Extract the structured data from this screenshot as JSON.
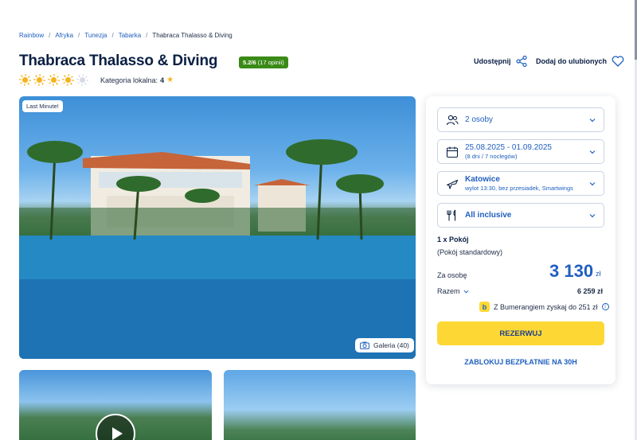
{
  "breadcrumb": [
    {
      "label": "Rainbow"
    },
    {
      "label": "Afryka"
    },
    {
      "label": "Tunezja"
    },
    {
      "label": "Tabarka"
    }
  ],
  "breadcrumb_current": "Thabraca Thalasso & Diving",
  "breadcrumb_separator": "/",
  "hotel": {
    "title": "Thabraca Thalasso & Diving",
    "rating_score": "5.2/6",
    "rating_reviews": "(17 opinii)",
    "sun_rating": 4,
    "sun_max": 5,
    "local_category_label": "Kategoria lokalna:",
    "local_category_value": "4"
  },
  "actions": {
    "share_label": "Udostępnij",
    "favorite_label": "Dodaj do ulubionych"
  },
  "photo": {
    "badge": "Last Minute!",
    "gallery_label": "Galeria (40)"
  },
  "booking": {
    "persons": "2 osoby",
    "dates": "25.08.2025 - 01.09.2025",
    "dates_sub": "(8 dni / 7 noclegów)",
    "departure": "Katowice",
    "departure_sub": "wylot 13:30, bez przesiadek, Smartwings",
    "board": "All inclusive",
    "room_count": "1 x Pokój",
    "room_type": "(Pokój standardowy)",
    "per_person_label": "Za osobę",
    "price": "3 130",
    "currency": "zł",
    "total_label": "Razem",
    "total_value": "6 259 zł",
    "boomerang_text": "Z Bumerangiem zyskaj do 251 zł",
    "boomerang_logo": "b",
    "reserve_label": "REZERWUJ",
    "block_label": "ZABLOKUJ BEZPŁATNIE NA 30H"
  },
  "colors": {
    "brand_blue": "#1f5fbf",
    "accent_yellow": "#fdd835",
    "rating_green": "#3a8a16",
    "sun": "#f6b21a"
  }
}
